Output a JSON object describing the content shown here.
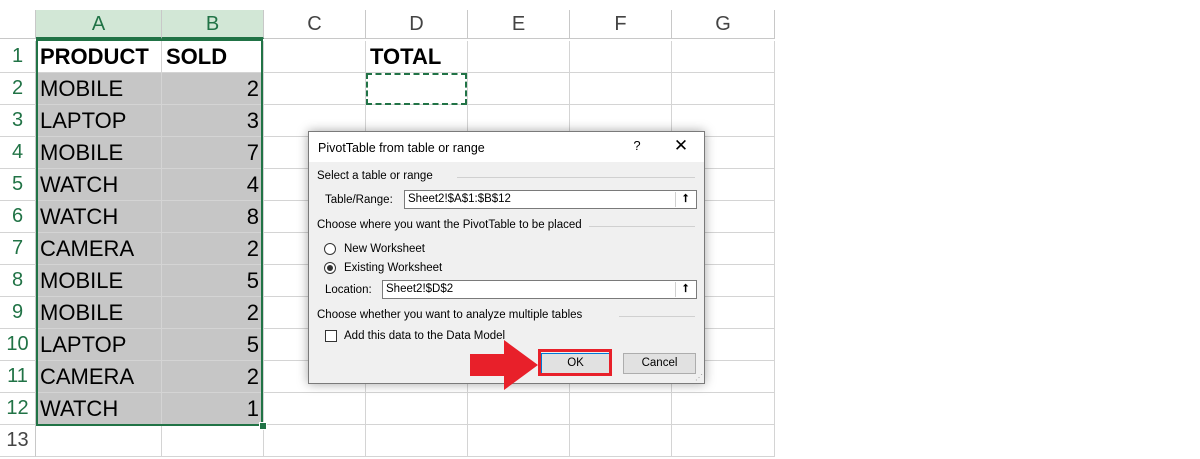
{
  "sheet": {
    "columns": [
      "A",
      "B",
      "C",
      "D",
      "E",
      "F",
      "G"
    ],
    "row_numbers": [
      "1",
      "2",
      "3",
      "4",
      "5",
      "6",
      "7",
      "8",
      "9",
      "10",
      "11",
      "12",
      "13"
    ],
    "header": {
      "product": "PRODUCT",
      "sold": "SOLD",
      "total": "TOTAL"
    },
    "rows": [
      {
        "product": "MOBILE",
        "sold": "2"
      },
      {
        "product": "LAPTOP",
        "sold": "3"
      },
      {
        "product": "MOBILE",
        "sold": "7"
      },
      {
        "product": "WATCH",
        "sold": "4"
      },
      {
        "product": "WATCH",
        "sold": "8"
      },
      {
        "product": "CAMERA",
        "sold": "2"
      },
      {
        "product": "MOBILE",
        "sold": "5"
      },
      {
        "product": "MOBILE",
        "sold": "2"
      },
      {
        "product": "LAPTOP",
        "sold": "5"
      },
      {
        "product": "CAMERA",
        "sold": "2"
      },
      {
        "product": "WATCH",
        "sold": "1"
      }
    ]
  },
  "dialog": {
    "title": "PivotTable from table or range",
    "help": "?",
    "close": "✕",
    "section_source": "Select a table or range",
    "range_label": "Table/Range:",
    "range_value": "Sheet2!$A$1:$B$12",
    "section_place": "Choose where you want the PivotTable to be placed",
    "opt_new": "New Worksheet",
    "opt_existing": "Existing Worksheet",
    "location_label": "Location:",
    "location_value": "Sheet2!$D$2",
    "section_multi": "Choose whether you want to analyze multiple tables",
    "data_model_label": "Add this data to the Data Model",
    "ok": "OK",
    "cancel": "Cancel",
    "collapse_icon_glyph": "⭡"
  },
  "colors": {
    "excel_green": "#217346",
    "selection_gray": "#c6c6c6",
    "highlight_red": "#e8202a"
  }
}
